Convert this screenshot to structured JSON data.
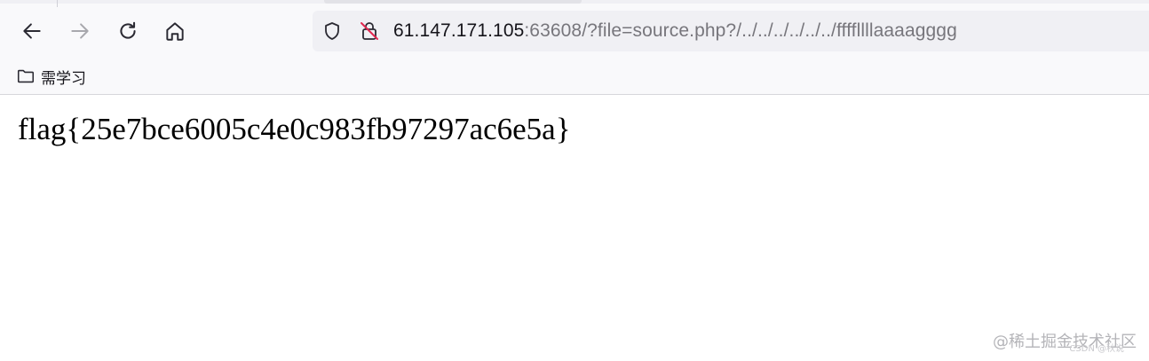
{
  "browser": {
    "nav": {
      "back_icon": "arrow-left-icon",
      "forward_icon": "arrow-right-icon",
      "reload_icon": "reload-icon",
      "home_icon": "home-icon"
    },
    "urlbar": {
      "host": "61.147.171.105",
      "rest": ":63608/?file=source.php?/../../../../../../ffffllllaaaagggg",
      "shield_icon": "tracking-protection-shield-icon",
      "insecure_icon": "insecure-lock-icon"
    },
    "bookmarks": [
      {
        "label": "需学习",
        "icon": "folder-icon"
      }
    ]
  },
  "page": {
    "flag_text": "flag{25e7bce6005c4e0c983fb97297ac6e5a}"
  },
  "watermark": {
    "text": "@稀土掘金技术社区",
    "sub": "CSDN @秋说"
  },
  "colors": {
    "toolbar_bg": "#f9f9fb",
    "urlbar_bg": "#f0f0f4",
    "insecure_slash": "#e22850"
  }
}
